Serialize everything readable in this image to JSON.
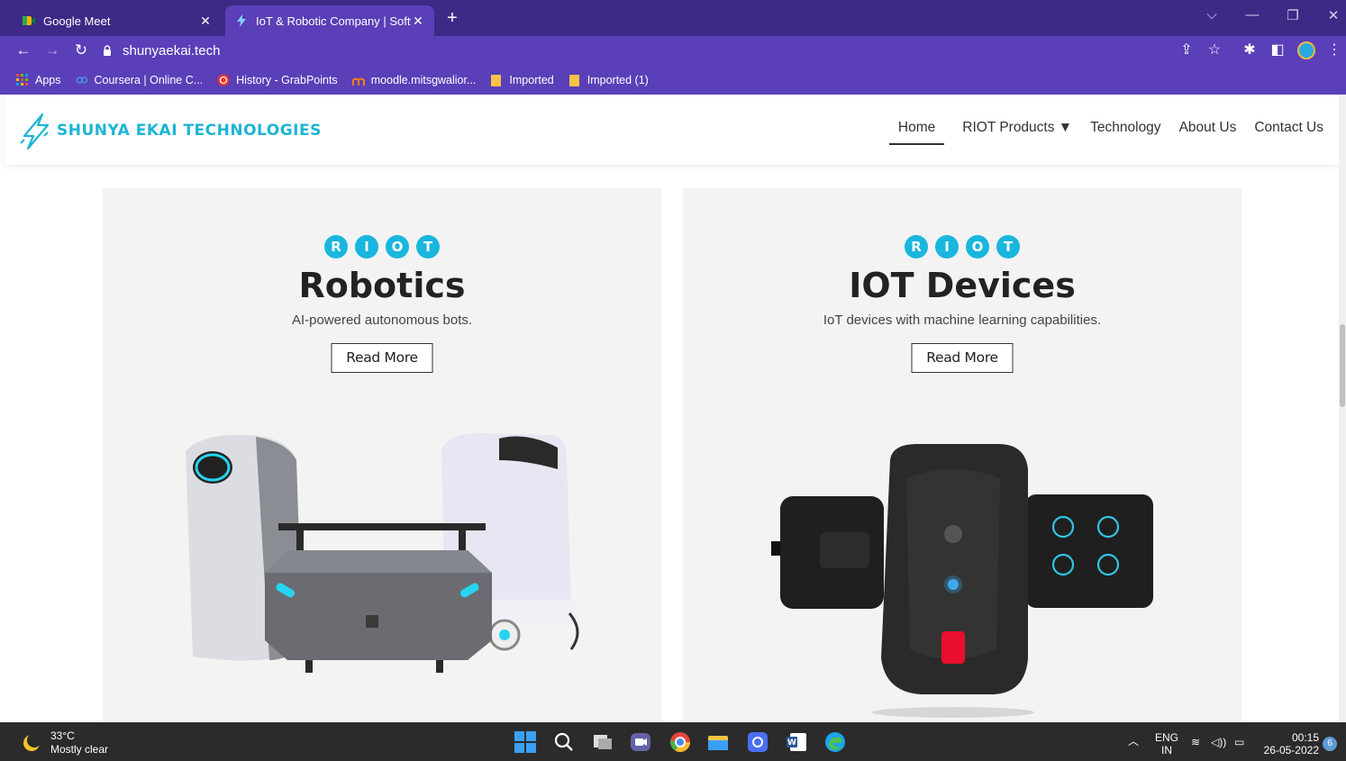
{
  "browser": {
    "tabs": [
      {
        "title": "Google Meet",
        "active": false
      },
      {
        "title": "IoT & Robotic Company | Software",
        "active": true
      }
    ],
    "new_tab": "+",
    "url": "shunyaekai.tech",
    "bookmarks": [
      {
        "label": "Apps",
        "icon": "apps-grid-icon"
      },
      {
        "label": "Coursera | Online C...",
        "icon": "coursera-icon"
      },
      {
        "label": "History - GrabPoints",
        "icon": "grabpoints-icon"
      },
      {
        "label": "moodle.mitsgwalior...",
        "icon": "moodle-icon"
      },
      {
        "label": "Imported",
        "icon": "folder-icon"
      },
      {
        "label": "Imported (1)",
        "icon": "folder-icon"
      }
    ]
  },
  "site": {
    "logo_text": "SHUNYA EKAI TECHNOLOGIES",
    "nav": [
      {
        "label": "Home",
        "current": true
      },
      {
        "label": "RIOT Products ▼",
        "current": false
      },
      {
        "label": "Technology",
        "current": false
      },
      {
        "label": "About Us",
        "current": false
      },
      {
        "label": "Contact Us",
        "current": false
      }
    ],
    "riot_letters": [
      "R",
      "I",
      "O",
      "T"
    ],
    "cards": [
      {
        "title": "Robotics",
        "subtitle": "AI-powered autonomous bots.",
        "button": "Read More"
      },
      {
        "title": "IOT Devices",
        "subtitle": "IoT devices with machine learning capabilities.",
        "button": "Read More"
      }
    ]
  },
  "taskbar": {
    "weather_temp": "33°C",
    "weather_desc": "Mostly clear",
    "lang_top": "ENG",
    "lang_bottom": "IN",
    "time": "00:15",
    "date": "26-05-2022",
    "notifications": "6"
  },
  "colors": {
    "tabbar": "#3c2a86",
    "toolbar": "#5a3fb8",
    "brand_cyan": "#19b6de"
  }
}
